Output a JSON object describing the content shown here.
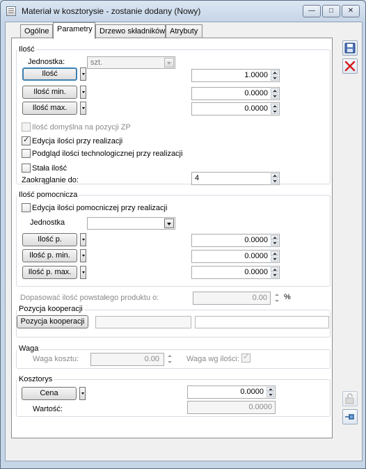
{
  "window": {
    "title": "Materiał w kosztorysie - zostanie dodany  (Nowy)",
    "minimize": "—",
    "maximize": "□",
    "close": "✕"
  },
  "tabs": [
    "Ogólne",
    "Parametry",
    "Drzewo składników",
    "Atrybuty"
  ],
  "ilosc": {
    "title": "Ilość",
    "jednostka_label": "Jednostka:",
    "jednostka_value": "szt.",
    "ilosc_button": "Ilość",
    "ilosc_value": "1.0000",
    "ilosc_min_button": "Ilość min.",
    "ilosc_min_value": "0.0000",
    "ilosc_max_button": "Ilość max.",
    "ilosc_max_value": "0.0000",
    "domyslna_label": "Ilość domyślna na pozycji ZP",
    "domyslna_checked": false,
    "edycja_label": "Edycja ilości przy realizacji",
    "edycja_checked": true,
    "podglad_label": "Podgląd ilości technologicznej przy realizacji",
    "podglad_checked": false,
    "stala_label": "Stała ilość",
    "stala_checked": false,
    "zaokraglanie_label": "Zaokrąglanie do:",
    "zaokraglanie_value": "4"
  },
  "ilosc_pomocnicza": {
    "title": "Ilość pomocnicza",
    "edycja_label": "Edycja ilości pomocniczej przy realizacji",
    "edycja_checked": false,
    "jednostka_label": "Jednostka",
    "jednostka_value": "",
    "ilosc_p_button": "Ilość p.",
    "ilosc_p_value": "0.0000",
    "ilosc_p_min_button": "Ilość p. min.",
    "ilosc_p_min_value": "0.0000",
    "ilosc_p_max_button": "Ilość p. max.",
    "ilosc_p_max_value": "0.0000"
  },
  "dopasowac": {
    "label": "Dopasować ilość powstałego produktu o:",
    "value": "0.00",
    "unit": "%"
  },
  "pozycja_kooperacji": {
    "title": "Pozycja kooperacji",
    "button": "Pozycja kooperacji",
    "field1": "",
    "field2": ""
  },
  "waga": {
    "title": "Waga",
    "koszt_label": "Waga kosztu:",
    "koszt_value": "0.00",
    "wg_ilosci_label": "Waga wg ilości:",
    "wg_ilosci_checked": true
  },
  "kosztorys": {
    "title": "Kosztorys",
    "cena_button": "Cena",
    "cena_value": "0.0000",
    "wartosc_label": "Wartość:",
    "wartosc_value": "0.0000"
  },
  "colors": {
    "title_bar": "#c6d6e8",
    "panel_bg": "#ffffff",
    "save_icon": "#3a5fa8",
    "delete_icon": "#d21f1f"
  },
  "icons": {
    "save": "save-icon",
    "delete": "delete-icon",
    "lock": "lock-icon",
    "pin": "pin-icon"
  }
}
